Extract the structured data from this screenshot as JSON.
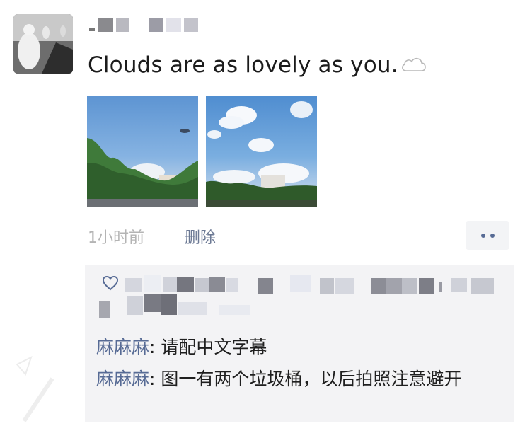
{
  "post": {
    "text": "Clouds are as lovely as you.",
    "time": "1小时前",
    "delete_label": "删除"
  },
  "icons": {
    "cloud": "cloud-icon",
    "heart": "heart-icon",
    "more": "more-dots-icon"
  },
  "colors": {
    "link": "#576b95",
    "meta": "#b4b4b4",
    "comment_bg": "#f3f3f5"
  },
  "comments": [
    {
      "author": "麻麻麻",
      "separator": ": ",
      "text": "请配中文字幕"
    },
    {
      "author": "麻麻麻",
      "separator": ": ",
      "text": "图一有两个垃圾桶，以后拍照注意避开"
    }
  ]
}
